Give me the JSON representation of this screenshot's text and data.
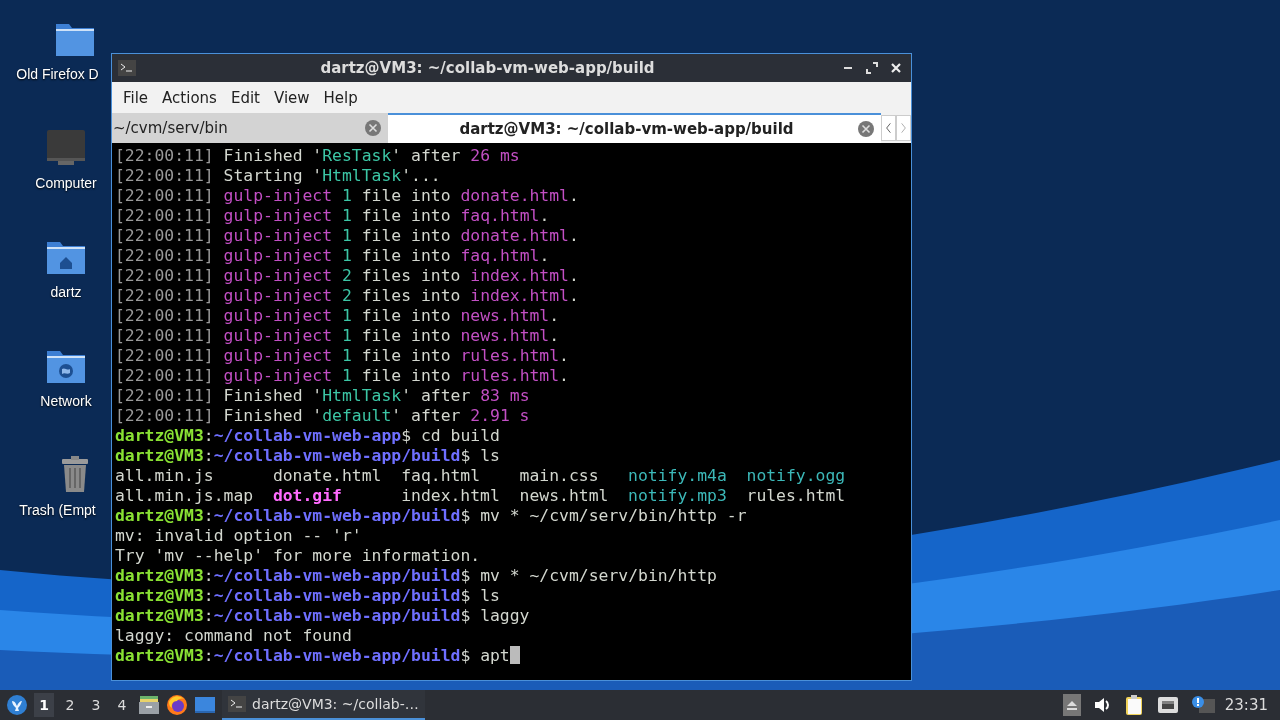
{
  "desktop_icons": [
    {
      "kind": "folder",
      "label": "Old Firefox D"
    },
    {
      "kind": "computer",
      "label": "Computer"
    },
    {
      "kind": "home",
      "label": "dartz"
    },
    {
      "kind": "network",
      "label": "Network"
    },
    {
      "kind": "trash",
      "label": "Trash (Empt"
    }
  ],
  "window": {
    "title": "dartz@VM3: ~/collab-vm-web-app/build",
    "menu": [
      "File",
      "Actions",
      "Edit",
      "View",
      "Help"
    ],
    "tabs": [
      {
        "label": "~/cvm/serv/bin",
        "selected": false
      },
      {
        "label": "dartz@VM3: ~/collab-vm-web-app/build",
        "selected": true
      }
    ],
    "terminal": [
      {
        "kind": "text",
        "segments": [
          {
            "text": "[22:00:11]",
            "kind": "time"
          },
          {
            "text": " Finished '",
            "kind": "plain"
          },
          {
            "text": "ResTask",
            "kind": "teal"
          },
          {
            "text": "' after ",
            "kind": "plain"
          },
          {
            "text": "26 ms",
            "kind": "magenta"
          }
        ]
      },
      {
        "kind": "text",
        "segments": [
          {
            "text": "[22:00:11]",
            "kind": "time"
          },
          {
            "text": " Starting '",
            "kind": "plain"
          },
          {
            "text": "HtmlTask",
            "kind": "teal"
          },
          {
            "text": "'...",
            "kind": "plain"
          }
        ]
      },
      {
        "kind": "text",
        "segments": [
          {
            "text": "[22:00:11]",
            "kind": "time"
          },
          {
            "text": " gulp-inject",
            "kind": "magenta"
          },
          {
            "text": " 1",
            "kind": "teal"
          },
          {
            "text": " file into ",
            "kind": "plain"
          },
          {
            "text": "donate.html",
            "kind": "magenta"
          },
          {
            "text": ".",
            "kind": "plain"
          }
        ]
      },
      {
        "kind": "text",
        "segments": [
          {
            "text": "[22:00:11]",
            "kind": "time"
          },
          {
            "text": " gulp-inject",
            "kind": "magenta"
          },
          {
            "text": " 1",
            "kind": "teal"
          },
          {
            "text": " file into ",
            "kind": "plain"
          },
          {
            "text": "faq.html",
            "kind": "magenta"
          },
          {
            "text": ".",
            "kind": "plain"
          }
        ]
      },
      {
        "kind": "text",
        "segments": [
          {
            "text": "[22:00:11]",
            "kind": "time"
          },
          {
            "text": " gulp-inject",
            "kind": "magenta"
          },
          {
            "text": " 1",
            "kind": "teal"
          },
          {
            "text": " file into ",
            "kind": "plain"
          },
          {
            "text": "donate.html",
            "kind": "magenta"
          },
          {
            "text": ".",
            "kind": "plain"
          }
        ]
      },
      {
        "kind": "text",
        "segments": [
          {
            "text": "[22:00:11]",
            "kind": "time"
          },
          {
            "text": " gulp-inject",
            "kind": "magenta"
          },
          {
            "text": " 1",
            "kind": "teal"
          },
          {
            "text": " file into ",
            "kind": "plain"
          },
          {
            "text": "faq.html",
            "kind": "magenta"
          },
          {
            "text": ".",
            "kind": "plain"
          }
        ]
      },
      {
        "kind": "text",
        "segments": [
          {
            "text": "[22:00:11]",
            "kind": "time"
          },
          {
            "text": " gulp-inject",
            "kind": "magenta"
          },
          {
            "text": " 2",
            "kind": "teal"
          },
          {
            "text": " files into ",
            "kind": "plain"
          },
          {
            "text": "index.html",
            "kind": "magenta"
          },
          {
            "text": ".",
            "kind": "plain"
          }
        ]
      },
      {
        "kind": "text",
        "segments": [
          {
            "text": "[22:00:11]",
            "kind": "time"
          },
          {
            "text": " gulp-inject",
            "kind": "magenta"
          },
          {
            "text": " 2",
            "kind": "teal"
          },
          {
            "text": " files into ",
            "kind": "plain"
          },
          {
            "text": "index.html",
            "kind": "magenta"
          },
          {
            "text": ".",
            "kind": "plain"
          }
        ]
      },
      {
        "kind": "text",
        "segments": [
          {
            "text": "[22:00:11]",
            "kind": "time"
          },
          {
            "text": " gulp-inject",
            "kind": "magenta"
          },
          {
            "text": " 1",
            "kind": "teal"
          },
          {
            "text": " file into ",
            "kind": "plain"
          },
          {
            "text": "news.html",
            "kind": "magenta"
          },
          {
            "text": ".",
            "kind": "plain"
          }
        ]
      },
      {
        "kind": "text",
        "segments": [
          {
            "text": "[22:00:11]",
            "kind": "time"
          },
          {
            "text": " gulp-inject",
            "kind": "magenta"
          },
          {
            "text": " 1",
            "kind": "teal"
          },
          {
            "text": " file into ",
            "kind": "plain"
          },
          {
            "text": "news.html",
            "kind": "magenta"
          },
          {
            "text": ".",
            "kind": "plain"
          }
        ]
      },
      {
        "kind": "text",
        "segments": [
          {
            "text": "[22:00:11]",
            "kind": "time"
          },
          {
            "text": " gulp-inject",
            "kind": "magenta"
          },
          {
            "text": " 1",
            "kind": "teal"
          },
          {
            "text": " file into ",
            "kind": "plain"
          },
          {
            "text": "rules.html",
            "kind": "magenta"
          },
          {
            "text": ".",
            "kind": "plain"
          }
        ]
      },
      {
        "kind": "text",
        "segments": [
          {
            "text": "[22:00:11]",
            "kind": "time"
          },
          {
            "text": " gulp-inject",
            "kind": "magenta"
          },
          {
            "text": " 1",
            "kind": "teal"
          },
          {
            "text": " file into ",
            "kind": "plain"
          },
          {
            "text": "rules.html",
            "kind": "magenta"
          },
          {
            "text": ".",
            "kind": "plain"
          }
        ]
      },
      {
        "kind": "text",
        "segments": [
          {
            "text": "[22:00:11]",
            "kind": "time"
          },
          {
            "text": " Finished '",
            "kind": "plain"
          },
          {
            "text": "HtmlTask",
            "kind": "teal"
          },
          {
            "text": "' after ",
            "kind": "plain"
          },
          {
            "text": "83 ms",
            "kind": "magenta"
          }
        ]
      },
      {
        "kind": "text",
        "segments": [
          {
            "text": "[22:00:11]",
            "kind": "time"
          },
          {
            "text": " Finished '",
            "kind": "plain"
          },
          {
            "text": "default",
            "kind": "teal"
          },
          {
            "text": "' after ",
            "kind": "plain"
          },
          {
            "text": "2.91 s",
            "kind": "magenta"
          }
        ]
      },
      {
        "kind": "text",
        "segments": [
          {
            "text": "dartz@VM3",
            "kind": "user"
          },
          {
            "text": ":",
            "kind": "plain"
          },
          {
            "text": "~/collab-vm-web-app",
            "kind": "path"
          },
          {
            "text": "$ cd build",
            "kind": "plain"
          }
        ]
      },
      {
        "kind": "text",
        "segments": [
          {
            "text": "dartz@VM3",
            "kind": "user"
          },
          {
            "text": ":",
            "kind": "plain"
          },
          {
            "text": "~/collab-vm-web-app/build",
            "kind": "path"
          },
          {
            "text": "$ ls",
            "kind": "plain"
          }
        ]
      },
      {
        "kind": "ls",
        "cells": [
          {
            "text": "all.min.js",
            "kind": "plain"
          },
          {
            "text": "donate.html",
            "kind": "plain"
          },
          {
            "text": "faq.html",
            "kind": "plain"
          },
          {
            "text": "main.css",
            "kind": "plain"
          },
          {
            "text": "notify.m4a",
            "kind": "cyan"
          },
          {
            "text": "notify.ogg",
            "kind": "cyan"
          }
        ]
      },
      {
        "kind": "ls",
        "cells": [
          {
            "text": "all.min.js.map",
            "kind": "plain"
          },
          {
            "text": "dot.gif",
            "kind": "image"
          },
          {
            "text": "index.html",
            "kind": "plain"
          },
          {
            "text": "news.html",
            "kind": "plain"
          },
          {
            "text": "notify.mp3",
            "kind": "cyan"
          },
          {
            "text": "rules.html",
            "kind": "plain"
          }
        ]
      },
      {
        "kind": "text",
        "segments": [
          {
            "text": "dartz@VM3",
            "kind": "user"
          },
          {
            "text": ":",
            "kind": "plain"
          },
          {
            "text": "~/collab-vm-web-app/build",
            "kind": "path"
          },
          {
            "text": "$ mv * ~/cvm/serv/bin/http -r",
            "kind": "plain"
          }
        ]
      },
      {
        "kind": "text",
        "segments": [
          {
            "text": "mv: invalid option -- 'r'",
            "kind": "plain"
          }
        ]
      },
      {
        "kind": "text",
        "segments": [
          {
            "text": "Try 'mv --help' for more information.",
            "kind": "plain"
          }
        ]
      },
      {
        "kind": "text",
        "segments": [
          {
            "text": "dartz@VM3",
            "kind": "user"
          },
          {
            "text": ":",
            "kind": "plain"
          },
          {
            "text": "~/collab-vm-web-app/build",
            "kind": "path"
          },
          {
            "text": "$ mv * ~/cvm/serv/bin/http",
            "kind": "plain"
          }
        ]
      },
      {
        "kind": "text",
        "segments": [
          {
            "text": "dartz@VM3",
            "kind": "user"
          },
          {
            "text": ":",
            "kind": "plain"
          },
          {
            "text": "~/collab-vm-web-app/build",
            "kind": "path"
          },
          {
            "text": "$ ls",
            "kind": "plain"
          }
        ]
      },
      {
        "kind": "text",
        "segments": [
          {
            "text": "dartz@VM3",
            "kind": "user"
          },
          {
            "text": ":",
            "kind": "plain"
          },
          {
            "text": "~/collab-vm-web-app/build",
            "kind": "path"
          },
          {
            "text": "$ laggy",
            "kind": "plain"
          }
        ]
      },
      {
        "kind": "text",
        "segments": [
          {
            "text": "laggy: command not found",
            "kind": "plain"
          }
        ]
      },
      {
        "kind": "text",
        "cursor": true,
        "segments": [
          {
            "text": "dartz@VM3",
            "kind": "user"
          },
          {
            "text": ":",
            "kind": "plain"
          },
          {
            "text": "~/collab-vm-web-app/build",
            "kind": "path"
          },
          {
            "text": "$ apt",
            "kind": "plain"
          }
        ]
      }
    ]
  },
  "taskbar": {
    "workspaces": [
      {
        "label": "1",
        "selected": true
      },
      {
        "label": "2",
        "selected": false
      },
      {
        "label": "3",
        "selected": false
      },
      {
        "label": "4",
        "selected": false
      }
    ],
    "launchers": [
      {
        "kind": "files"
      },
      {
        "kind": "browser"
      },
      {
        "kind": "desktop"
      }
    ],
    "tasks": [
      {
        "label": "dartz@VM3: ~/collab-…",
        "selected": true
      }
    ],
    "tray": [
      {
        "kind": "eject"
      },
      {
        "kind": "volume"
      },
      {
        "kind": "clipboard"
      },
      {
        "kind": "network"
      },
      {
        "kind": "notification"
      }
    ],
    "clock": "23:31"
  }
}
